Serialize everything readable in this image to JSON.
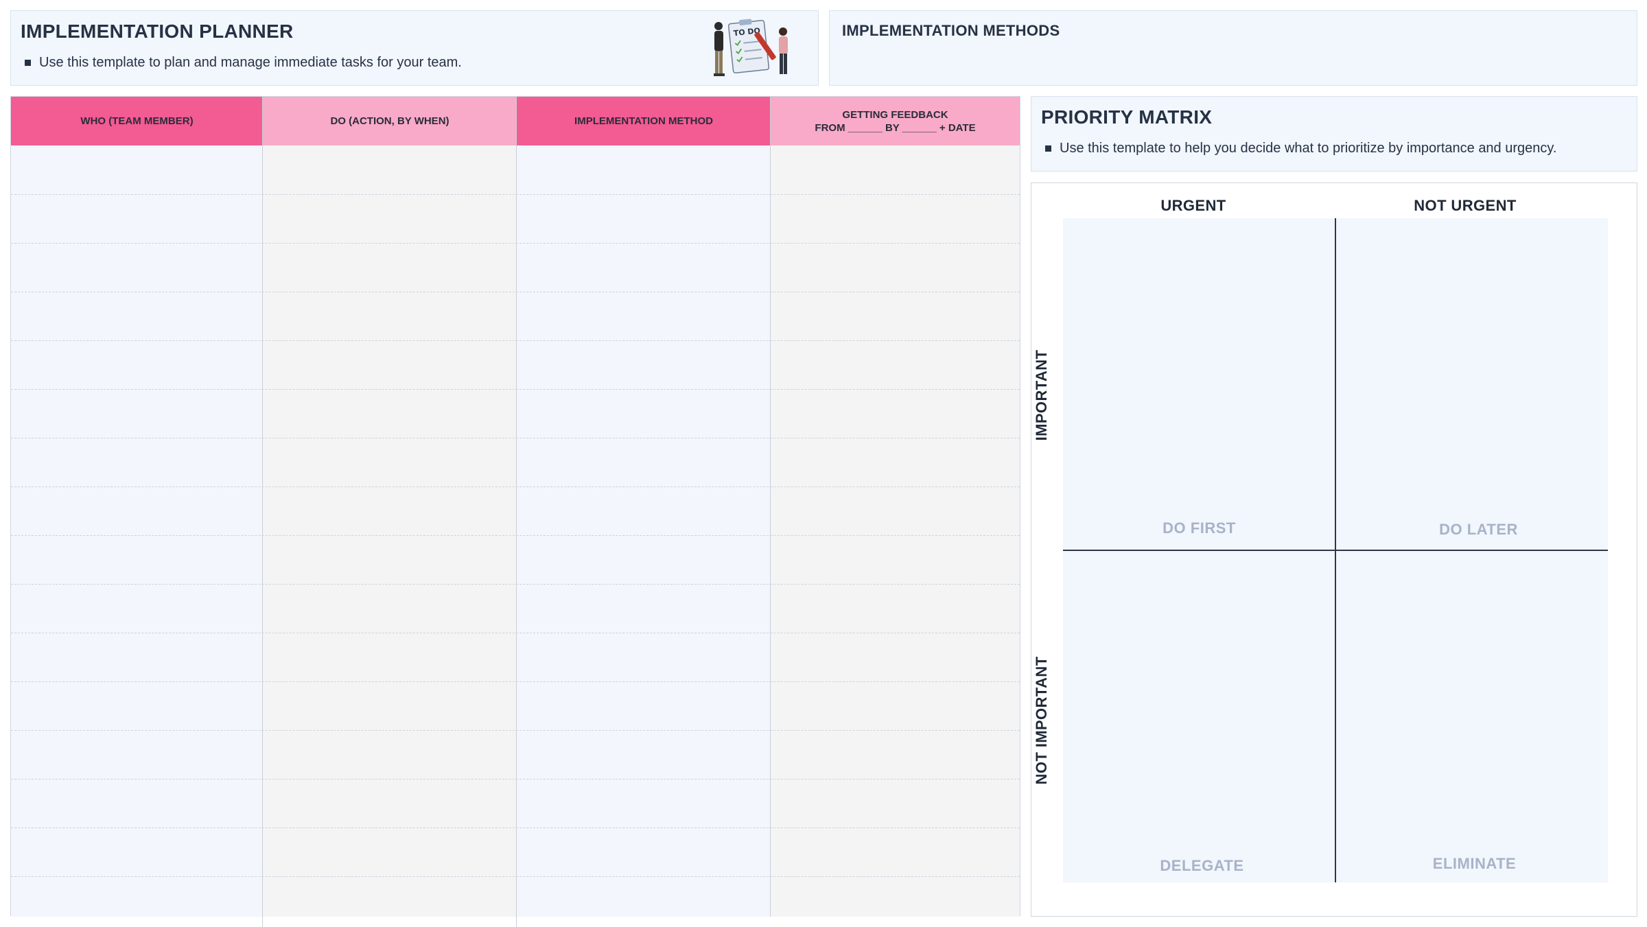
{
  "planner": {
    "title": "IMPLEMENTATION PLANNER",
    "description": "Use this template to plan and manage immediate tasks for your team.",
    "illustration_label": "TO DO"
  },
  "methods": {
    "title": "IMPLEMENTATION METHODS"
  },
  "table": {
    "headers": [
      {
        "line1": "WHO (TEAM MEMBER)",
        "line2": ""
      },
      {
        "line1": "DO (ACTION, BY WHEN)",
        "line2": ""
      },
      {
        "line1": "IMPLEMENTATION METHOD",
        "line2": ""
      },
      {
        "line1": "GETTING FEEDBACK",
        "line2": "FROM ______ BY ______ + DATE"
      }
    ],
    "header_colors": [
      "#f35b93",
      "#f8aac8",
      "#f35b93",
      "#f8aac8"
    ]
  },
  "priority": {
    "title": "PRIORITY MATRIX",
    "description": "Use this template to help you decide what to prioritize by importance and urgency.",
    "col_labels": [
      "URGENT",
      "NOT URGENT"
    ],
    "row_labels": [
      "IMPORTANT",
      "NOT IMPORTANT"
    ],
    "quadrants": [
      "DO FIRST",
      "DO LATER",
      "DELEGATE",
      "ELIMINATE"
    ]
  }
}
